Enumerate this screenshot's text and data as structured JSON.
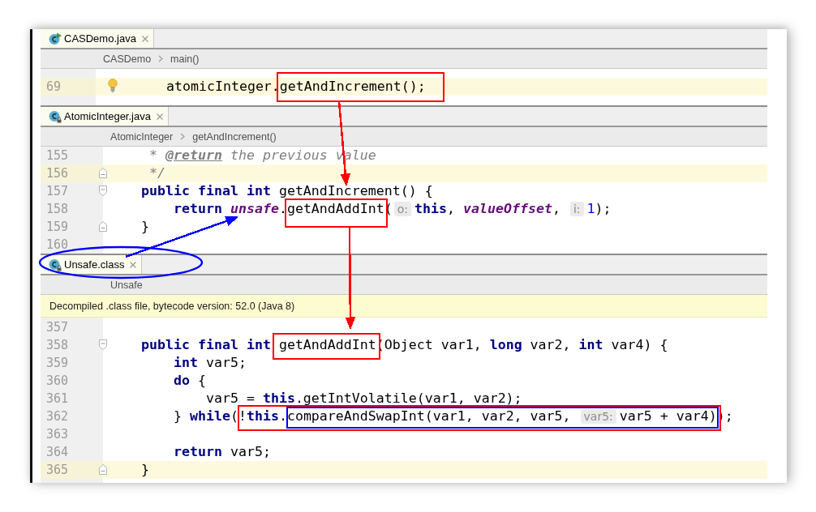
{
  "panes": [
    {
      "tab": {
        "label": "CASDemo.java",
        "kind": "runnable",
        "selected": true
      },
      "breadcrumbs": [
        "CASDemo",
        "main()"
      ],
      "lines": [
        {
          "number": "69",
          "highlighted": true,
          "fold_start": false,
          "fold_end": false,
          "bulb": true,
          "runs": [
            {
              "kind": "plain",
              "text": "        atomicInteger.getAndIncrement();"
            }
          ]
        }
      ]
    },
    {
      "tab": {
        "label": "AtomicInteger.java",
        "kind": "read_only",
        "selected": true
      },
      "breadcrumbs": [
        "AtomicInteger",
        "getAndIncrement()"
      ],
      "lines": [
        {
          "number": "155",
          "highlighted": false,
          "fold_start": false,
          "fold_end": false,
          "runs": [
            {
              "kind": "comment",
              "text": "     * "
            },
            {
              "kind": "doc_tag",
              "text": "@return"
            },
            {
              "kind": "comment",
              "text": " the previous value"
            }
          ]
        },
        {
          "number": "156",
          "highlighted": true,
          "fold_start": false,
          "fold_end": true,
          "runs": [
            {
              "kind": "comment",
              "text": "     */"
            }
          ]
        },
        {
          "number": "157",
          "highlighted": false,
          "fold_start": true,
          "fold_end": false,
          "runs": [
            {
              "kind": "keyword",
              "text": "    public final int"
            },
            {
              "kind": "plain",
              "text": " getAndIncrement() {"
            }
          ]
        },
        {
          "number": "158",
          "highlighted": false,
          "fold_start": false,
          "fold_end": false,
          "runs": [
            {
              "kind": "keyword",
              "text": "        return "
            },
            {
              "kind": "field",
              "text": "unsafe"
            },
            {
              "kind": "plain",
              "text": ".getAndAddInt("
            },
            {
              "kind": "hint",
              "text": "o:"
            },
            {
              "kind": "keyword",
              "text": "this"
            },
            {
              "kind": "plain",
              "text": ", "
            },
            {
              "kind": "field",
              "text": "valueOffset"
            },
            {
              "kind": "plain",
              "text": ", "
            },
            {
              "kind": "hint",
              "text": "i:"
            },
            {
              "kind": "number",
              "text": "1"
            },
            {
              "kind": "plain",
              "text": ");"
            }
          ]
        },
        {
          "number": "159",
          "highlighted": false,
          "fold_start": false,
          "fold_end": true,
          "runs": [
            {
              "kind": "plain",
              "text": "    }"
            }
          ]
        },
        {
          "number": "160",
          "highlighted": false,
          "fold_start": false,
          "fold_end": false
        }
      ]
    },
    {
      "tab": {
        "label": "Unsafe.class",
        "kind": "read_only",
        "selected": true
      },
      "breadcrumbs": [
        "Unsafe"
      ],
      "notice": "Decompiled .class file, bytecode version: 52.0 (Java 8)",
      "lines": [
        {
          "number": "357",
          "highlighted": false,
          "fold_start": false,
          "fold_end": false
        },
        {
          "number": "358",
          "highlighted": false,
          "fold_start": true,
          "fold_end": false,
          "runs": [
            {
              "kind": "keyword",
              "text": "    public final int"
            },
            {
              "kind": "plain",
              "text": " getAndAddInt(Object var1, "
            },
            {
              "kind": "keyword",
              "text": "long"
            },
            {
              "kind": "plain",
              "text": " var2, "
            },
            {
              "kind": "keyword",
              "text": "int"
            },
            {
              "kind": "plain",
              "text": " var4) {"
            }
          ]
        },
        {
          "number": "359",
          "highlighted": false,
          "fold_start": false,
          "fold_end": false,
          "runs": [
            {
              "kind": "keyword",
              "text": "        int"
            },
            {
              "kind": "plain",
              "text": " var5;"
            }
          ]
        },
        {
          "number": "360",
          "highlighted": false,
          "fold_start": false,
          "fold_end": false,
          "runs": [
            {
              "kind": "keyword",
              "text": "        do"
            },
            {
              "kind": "plain",
              "text": " {"
            }
          ]
        },
        {
          "number": "361",
          "highlighted": false,
          "fold_start": false,
          "fold_end": false,
          "runs": [
            {
              "kind": "plain",
              "text": "            var5 = "
            },
            {
              "kind": "keyword",
              "text": "this"
            },
            {
              "kind": "plain",
              "text": ".getIntVolatile(var1, var2);"
            }
          ]
        },
        {
          "number": "362",
          "highlighted": false,
          "fold_start": false,
          "fold_end": false,
          "runs": [
            {
              "kind": "plain",
              "text": "        } "
            },
            {
              "kind": "keyword",
              "text": "while"
            },
            {
              "kind": "plain",
              "text": "(!"
            },
            {
              "kind": "keyword",
              "text": "this"
            },
            {
              "kind": "plain",
              "text": ".compareAndSwapInt(var1, var2, var5, "
            },
            {
              "kind": "hint",
              "text": "var5:"
            },
            {
              "kind": "plain",
              "text": "var5 + var4));"
            }
          ]
        },
        {
          "number": "363",
          "highlighted": false,
          "fold_start": false,
          "fold_end": false
        },
        {
          "number": "364",
          "highlighted": false,
          "fold_start": false,
          "fold_end": false,
          "runs": [
            {
              "kind": "keyword",
              "text": "        return"
            },
            {
              "kind": "plain",
              "text": " var5;"
            }
          ]
        },
        {
          "number": "365",
          "highlighted": true,
          "fold_start": false,
          "fold_end": true,
          "runs": [
            {
              "kind": "plain",
              "text": "    }"
            }
          ]
        }
      ]
    }
  ],
  "annotations": [
    {
      "kind": "box",
      "color": "#ff0000"
    },
    {
      "kind": "arrow",
      "color": "#ff0000"
    },
    {
      "kind": "box",
      "color": "#ff0000"
    },
    {
      "kind": "arrow",
      "color": "#ff0000"
    },
    {
      "kind": "box",
      "color": "#ff0000"
    },
    {
      "kind": "box",
      "color": "#ff0000"
    },
    {
      "kind": "box",
      "color": "#0000ff"
    },
    {
      "kind": "ellipse",
      "color": "#0000ff"
    },
    {
      "kind": "arrow",
      "color": "#0000ff"
    }
  ]
}
